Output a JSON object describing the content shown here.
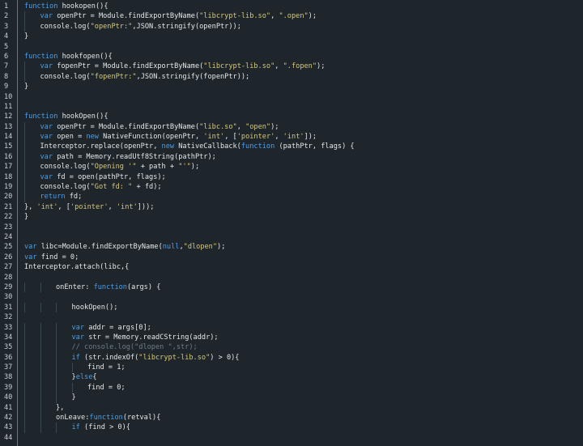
{
  "editor": {
    "lines": [
      {
        "n": "1",
        "indent": 0,
        "tokens": [
          {
            "t": "function",
            "c": "k"
          },
          {
            "t": " hookopen(){",
            "c": "p"
          }
        ]
      },
      {
        "n": "2",
        "indent": 1,
        "tokens": [
          {
            "t": "var",
            "c": "k"
          },
          {
            "t": " openPtr = Module.findExportByName(",
            "c": "p"
          },
          {
            "t": "\"libcrypt-lib.so\"",
            "c": "s"
          },
          {
            "t": ", ",
            "c": "p"
          },
          {
            "t": "\".open\"",
            "c": "s"
          },
          {
            "t": ");",
            "c": "p"
          }
        ]
      },
      {
        "n": "3",
        "indent": 1,
        "tokens": [
          {
            "t": "console.log(",
            "c": "p"
          },
          {
            "t": "\"openPtr:\"",
            "c": "s"
          },
          {
            "t": ",JSON.stringify(openPtr));",
            "c": "p"
          }
        ]
      },
      {
        "n": "4",
        "indent": 0,
        "tokens": [
          {
            "t": "}",
            "c": "p"
          }
        ]
      },
      {
        "n": "5",
        "indent": 0,
        "tokens": []
      },
      {
        "n": "6",
        "indent": 0,
        "tokens": [
          {
            "t": "function",
            "c": "k"
          },
          {
            "t": " hookfopen(){",
            "c": "p"
          }
        ]
      },
      {
        "n": "7",
        "indent": 1,
        "tokens": [
          {
            "t": "var",
            "c": "k"
          },
          {
            "t": " fopenPtr = Module.findExportByName(",
            "c": "p"
          },
          {
            "t": "\"libcrypt-lib.so\"",
            "c": "s"
          },
          {
            "t": ", ",
            "c": "p"
          },
          {
            "t": "\".fopen\"",
            "c": "s"
          },
          {
            "t": ");",
            "c": "p"
          }
        ]
      },
      {
        "n": "8",
        "indent": 1,
        "tokens": [
          {
            "t": "console.log(",
            "c": "p"
          },
          {
            "t": "\"fopenPtr:\"",
            "c": "s"
          },
          {
            "t": ",JSON.stringify(fopenPtr));",
            "c": "p"
          }
        ]
      },
      {
        "n": "9",
        "indent": 0,
        "tokens": [
          {
            "t": "}",
            "c": "p"
          }
        ]
      },
      {
        "n": "10",
        "indent": 0,
        "tokens": []
      },
      {
        "n": "11",
        "indent": 0,
        "tokens": []
      },
      {
        "n": "12",
        "indent": 0,
        "tokens": [
          {
            "t": "function",
            "c": "k"
          },
          {
            "t": " hookOpen(){",
            "c": "p"
          }
        ]
      },
      {
        "n": "13",
        "indent": 1,
        "tokens": [
          {
            "t": "var",
            "c": "k"
          },
          {
            "t": " openPtr = Module.findExportByName(",
            "c": "p"
          },
          {
            "t": "\"libc.so\"",
            "c": "s"
          },
          {
            "t": ", ",
            "c": "p"
          },
          {
            "t": "\"open\"",
            "c": "s"
          },
          {
            "t": ");",
            "c": "p"
          }
        ]
      },
      {
        "n": "14",
        "indent": 1,
        "tokens": [
          {
            "t": "var",
            "c": "k"
          },
          {
            "t": " open = ",
            "c": "p"
          },
          {
            "t": "new",
            "c": "k"
          },
          {
            "t": " NativeFunction(openPtr, ",
            "c": "p"
          },
          {
            "t": "'int'",
            "c": "s"
          },
          {
            "t": ", [",
            "c": "p"
          },
          {
            "t": "'pointer'",
            "c": "s"
          },
          {
            "t": ", ",
            "c": "p"
          },
          {
            "t": "'int'",
            "c": "s"
          },
          {
            "t": "]);",
            "c": "p"
          }
        ]
      },
      {
        "n": "15",
        "indent": 1,
        "tokens": [
          {
            "t": "Interceptor.replace(openPtr, ",
            "c": "p"
          },
          {
            "t": "new",
            "c": "k"
          },
          {
            "t": " NativeCallback(",
            "c": "p"
          },
          {
            "t": "function",
            "c": "k"
          },
          {
            "t": " (pathPtr, flags) {",
            "c": "p"
          }
        ]
      },
      {
        "n": "16",
        "indent": 1,
        "tokens": [
          {
            "t": "var",
            "c": "k"
          },
          {
            "t": " path = Memory.readUtf8String(pathPtr);",
            "c": "p"
          }
        ]
      },
      {
        "n": "17",
        "indent": 1,
        "tokens": [
          {
            "t": "console.log(",
            "c": "p"
          },
          {
            "t": "\"Opening '\"",
            "c": "s"
          },
          {
            "t": " + path + ",
            "c": "p"
          },
          {
            "t": "\"'\"",
            "c": "s"
          },
          {
            "t": ");",
            "c": "p"
          }
        ]
      },
      {
        "n": "18",
        "indent": 1,
        "tokens": [
          {
            "t": "var",
            "c": "k"
          },
          {
            "t": " fd = open(pathPtr, flags);",
            "c": "p"
          }
        ]
      },
      {
        "n": "19",
        "indent": 1,
        "tokens": [
          {
            "t": "console.log(",
            "c": "p"
          },
          {
            "t": "\"Got fd: \"",
            "c": "s"
          },
          {
            "t": " + fd);",
            "c": "p"
          }
        ]
      },
      {
        "n": "20",
        "indent": 1,
        "tokens": [
          {
            "t": "return",
            "c": "k"
          },
          {
            "t": " fd;",
            "c": "p"
          }
        ]
      },
      {
        "n": "21",
        "indent": 0,
        "tokens": [
          {
            "t": "}, ",
            "c": "p"
          },
          {
            "t": "'int'",
            "c": "s"
          },
          {
            "t": ", [",
            "c": "p"
          },
          {
            "t": "'pointer'",
            "c": "s"
          },
          {
            "t": ", ",
            "c": "p"
          },
          {
            "t": "'int'",
            "c": "s"
          },
          {
            "t": "]));",
            "c": "p"
          }
        ]
      },
      {
        "n": "22",
        "indent": 0,
        "tokens": [
          {
            "t": "}",
            "c": "p"
          }
        ]
      },
      {
        "n": "23",
        "indent": 0,
        "tokens": []
      },
      {
        "n": "24",
        "indent": 0,
        "tokens": []
      },
      {
        "n": "25",
        "indent": 0,
        "tokens": [
          {
            "t": "var",
            "c": "k"
          },
          {
            "t": " libc=Module.findExportByName(",
            "c": "p"
          },
          {
            "t": "null",
            "c": "k"
          },
          {
            "t": ",",
            "c": "p"
          },
          {
            "t": "\"dlopen\"",
            "c": "s"
          },
          {
            "t": ");",
            "c": "p"
          }
        ]
      },
      {
        "n": "26",
        "indent": 0,
        "tokens": [
          {
            "t": "var",
            "c": "k"
          },
          {
            "t": " find = 0;",
            "c": "p"
          }
        ]
      },
      {
        "n": "27",
        "indent": 0,
        "tokens": [
          {
            "t": "Interceptor.attach(libc,{",
            "c": "p"
          }
        ]
      },
      {
        "n": "28",
        "indent": 0,
        "tokens": []
      },
      {
        "n": "29",
        "indent": 2,
        "tokens": [
          {
            "t": "onEnter: ",
            "c": "p"
          },
          {
            "t": "function",
            "c": "k"
          },
          {
            "t": "(args) {",
            "c": "p"
          }
        ]
      },
      {
        "n": "30",
        "indent": 0,
        "tokens": []
      },
      {
        "n": "31",
        "indent": 3,
        "tokens": [
          {
            "t": "hookOpen();",
            "c": "p"
          }
        ]
      },
      {
        "n": "32",
        "indent": 0,
        "tokens": []
      },
      {
        "n": "33",
        "indent": 3,
        "tokens": [
          {
            "t": "var",
            "c": "k"
          },
          {
            "t": " addr = args[0];",
            "c": "p"
          }
        ]
      },
      {
        "n": "34",
        "indent": 3,
        "tokens": [
          {
            "t": "var",
            "c": "k"
          },
          {
            "t": " str = Memory.readCString(addr);",
            "c": "p"
          }
        ]
      },
      {
        "n": "35",
        "indent": 3,
        "tokens": [
          {
            "t": "// console.log(\"dlopen \",str);",
            "c": "c"
          }
        ]
      },
      {
        "n": "36",
        "indent": 3,
        "tokens": [
          {
            "t": "if",
            "c": "k"
          },
          {
            "t": " (str.indexOf(",
            "c": "p"
          },
          {
            "t": "\"libcrypt-lib.so\"",
            "c": "s"
          },
          {
            "t": ") > 0){",
            "c": "p"
          }
        ]
      },
      {
        "n": "37",
        "indent": 4,
        "tokens": [
          {
            "t": "find = 1;",
            "c": "p"
          }
        ]
      },
      {
        "n": "38",
        "indent": 3,
        "tokens": [
          {
            "t": "}",
            "c": "p"
          },
          {
            "t": "else",
            "c": "k"
          },
          {
            "t": "{",
            "c": "p"
          }
        ]
      },
      {
        "n": "39",
        "indent": 4,
        "tokens": [
          {
            "t": "find = 0;",
            "c": "p"
          }
        ]
      },
      {
        "n": "40",
        "indent": 3,
        "tokens": [
          {
            "t": "}",
            "c": "p"
          }
        ]
      },
      {
        "n": "41",
        "indent": 2,
        "tokens": [
          {
            "t": "},",
            "c": "p"
          }
        ]
      },
      {
        "n": "42",
        "indent": 2,
        "tokens": [
          {
            "t": "onLeave:",
            "c": "p"
          },
          {
            "t": "function",
            "c": "k"
          },
          {
            "t": "(retval){",
            "c": "p"
          }
        ]
      },
      {
        "n": "43",
        "indent": 3,
        "tokens": [
          {
            "t": "if",
            "c": "k"
          },
          {
            "t": " (find > 0){",
            "c": "p"
          }
        ]
      },
      {
        "n": "44",
        "indent": 0,
        "tokens": []
      }
    ]
  },
  "colors": {
    "background": "#1e252b",
    "keyword": "#4d9fe8",
    "string": "#d8c878",
    "comment": "#6c7d88",
    "plain": "#e4e8ea",
    "gutter_rule": "#3a8a8a"
  }
}
